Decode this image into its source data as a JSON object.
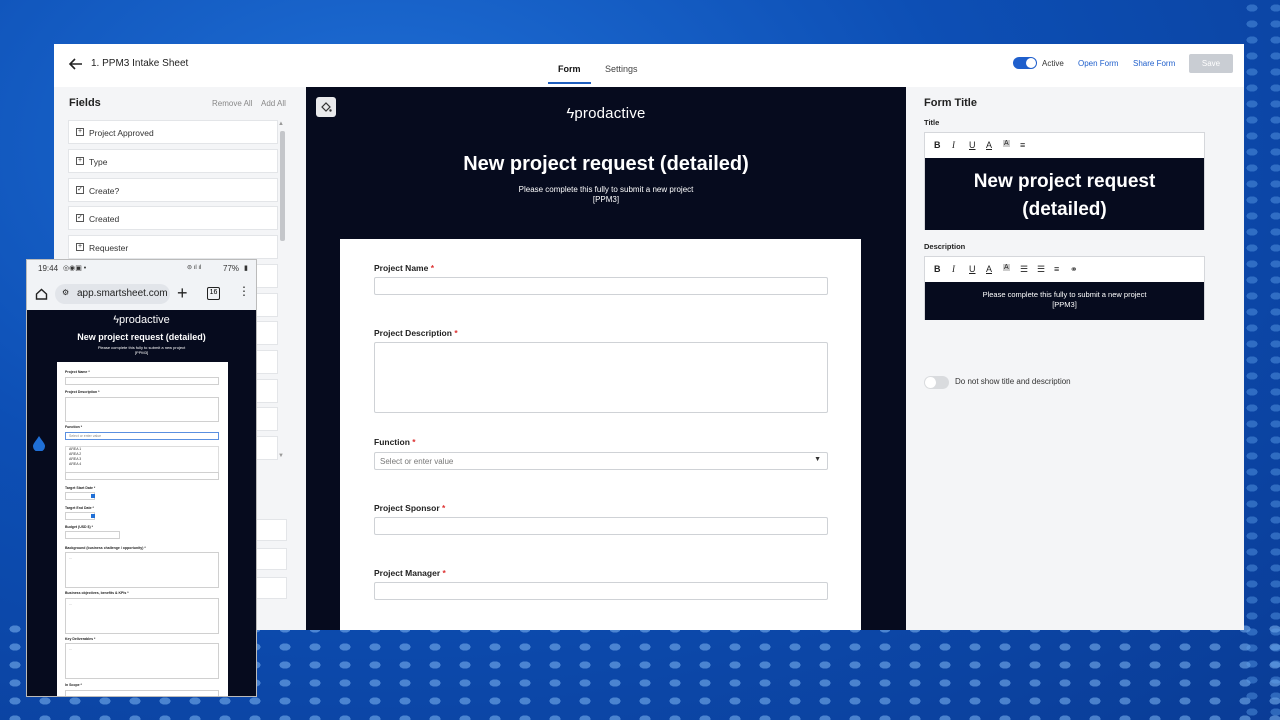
{
  "topbar": {
    "sheet_title": "1. PPM3 Intake Sheet",
    "tabs": [
      "Form",
      "Settings"
    ],
    "active_label": "Active",
    "open_form": "Open Form",
    "share_form": "Share Form",
    "save_label": "Save"
  },
  "fields_panel": {
    "title": "Fields",
    "remove_all": "Remove All",
    "add_all": "Add All",
    "items": [
      {
        "label": "Project Approved",
        "icon": "plus-box-icon"
      },
      {
        "label": "Type",
        "icon": "plus-box-icon"
      },
      {
        "label": "Create?",
        "icon": "checked-box-icon"
      },
      {
        "label": "Created",
        "icon": "checked-box-icon"
      },
      {
        "label": "Requester",
        "icon": "plus-box-icon"
      }
    ]
  },
  "preview": {
    "logo_text": "prodactive",
    "title": "New project request (detailed)",
    "description_line1": "Please complete this fully to submit a new project",
    "description_line2": "[PPM3]",
    "questions": [
      {
        "label": "Project Name",
        "required": "*"
      },
      {
        "label": "Project Description",
        "required": "*"
      },
      {
        "label": "Function",
        "required": "*",
        "placeholder": "Select or enter value"
      },
      {
        "label": "Project Sponsor",
        "required": "*"
      },
      {
        "label": "Project Manager",
        "required": "*"
      }
    ]
  },
  "props": {
    "title": "Form Title",
    "title_label": "Title",
    "title_text_line1": "New project request",
    "title_text_line2": "(detailed)",
    "description_label": "Description",
    "description_line1": "Please complete this fully to submit a new project",
    "description_line2": "[PPM3]",
    "toolbar_title": [
      "B",
      "I",
      "U",
      "A",
      "A",
      "≡"
    ],
    "toolbar_desc": [
      "B",
      "I",
      "U",
      "A",
      "A",
      "☰",
      "☰",
      "≡",
      "⚭"
    ],
    "hide_label": "Do not show title and description"
  },
  "phone": {
    "time": "19:44",
    "battery": "77%",
    "url": "app.smartsheet.com",
    "tab_count": "16",
    "logo_text": "prodactive",
    "title": "New project request (detailed)",
    "description_line1": "Please complete this fully to submit a new project",
    "description_line2": "[PPM3]",
    "fields": {
      "project_name": "Project Name *",
      "project_description": "Project Description *",
      "function": "Function *",
      "function_placeholder": "Select or enter value",
      "options": [
        "AREA 1",
        "AREA 2",
        "AREA 3",
        "AREA 4"
      ],
      "target_start": "Target Start Date *",
      "target_end": "Target End Date *",
      "budget": "Budget (USD $) *",
      "background": "Background (business challenge / opportunity) *",
      "objectives": "Business objectives, benefits & KPIs *",
      "deliverables": "Key Deliverables *",
      "in_scope": "In Scope *",
      "textarea_value": "..."
    }
  },
  "colors": {
    "accent": "#1f5fcc",
    "form_bg": "#060b1e",
    "required": "#dd3333"
  }
}
